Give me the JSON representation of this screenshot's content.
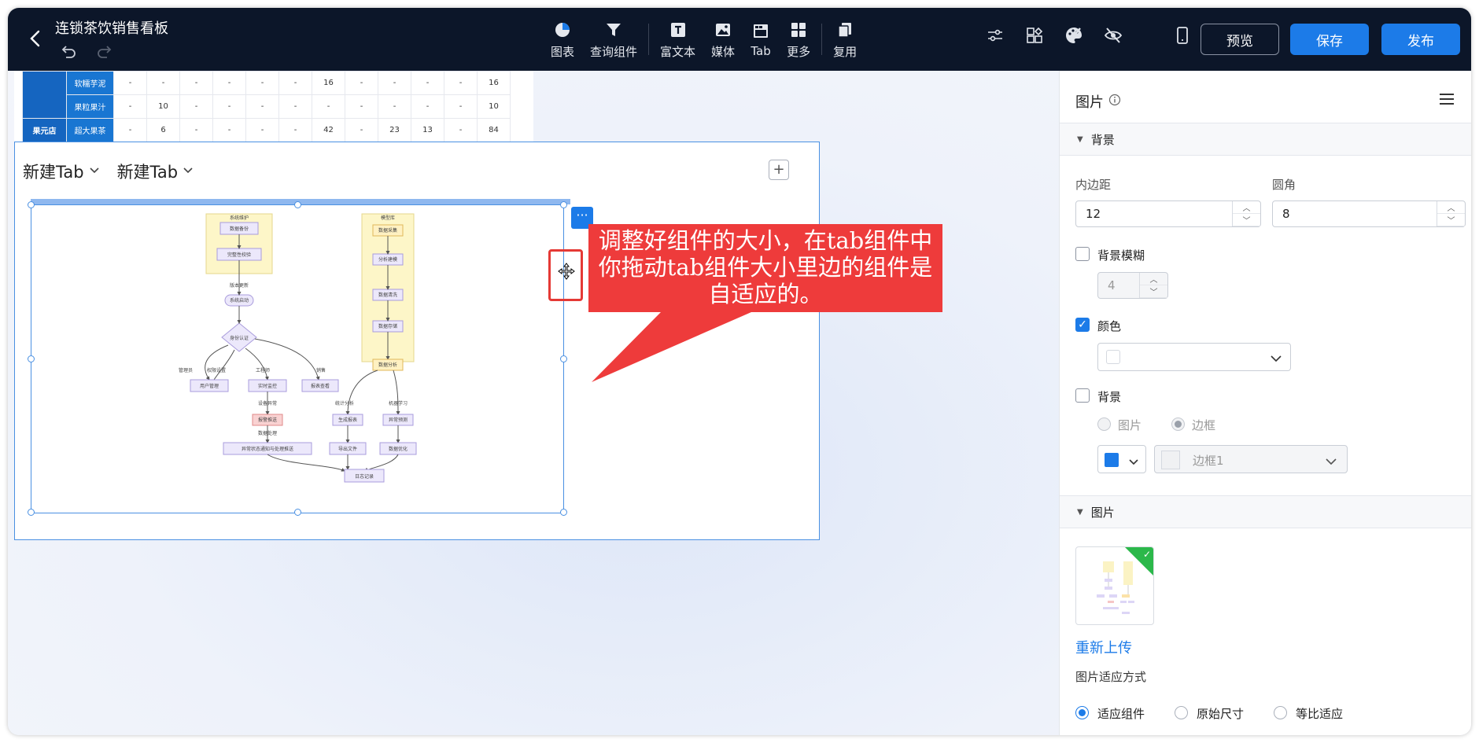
{
  "header": {
    "title": "连锁茶饮销售看板",
    "tools": [
      {
        "label": "图表",
        "icon": "chart-icon"
      },
      {
        "label": "查询组件",
        "icon": "filter-icon"
      },
      {
        "label": "富文本",
        "icon": "rich-text-icon"
      },
      {
        "label": "媒体",
        "icon": "media-icon"
      },
      {
        "label": "Tab",
        "icon": "tab-icon"
      },
      {
        "label": "更多",
        "icon": "more-grid-icon"
      },
      {
        "label": "复用",
        "icon": "reuse-icon"
      }
    ],
    "preview_label": "预览",
    "save_label": "保存",
    "publish_label": "发布"
  },
  "table": {
    "store_label": "果元店",
    "rows": [
      {
        "item": "软糯芋泥",
        "cells": [
          "-",
          "-",
          "-",
          "-",
          "-",
          "-",
          "16",
          "-",
          "-",
          "-",
          "-",
          "16"
        ]
      },
      {
        "item": "果粒果汁",
        "cells": [
          "-",
          "10",
          "-",
          "-",
          "-",
          "-",
          "-",
          "-",
          "-",
          "-",
          "-",
          "10"
        ]
      },
      {
        "item": "超大果茶",
        "cells": [
          "-",
          "6",
          "-",
          "-",
          "-",
          "-",
          "42",
          "-",
          "23",
          "13",
          "-",
          "84"
        ]
      }
    ]
  },
  "tabs": [
    {
      "label": "新建Tab"
    },
    {
      "label": "新建Tab"
    }
  ],
  "add_tab_label": "+",
  "more_button_label": "···",
  "callout_text": "调整好组件的大小，在tab组件中你拖动tab组件大小里边的组件是自适应的。",
  "flowchart": {
    "group_left_title": "系统维护",
    "group_right_title": "模型库",
    "nodes": {
      "n1": "数据备份",
      "n2": "完整性校验",
      "e1": "版本更新",
      "n3": "系统启动",
      "d1": "身份认证",
      "e2": "管理员",
      "e3": "权限设置",
      "e4": "工程师",
      "e5": "销售",
      "n4": "用户管理",
      "n5": "实时监控",
      "n6": "报表查看",
      "r1": "数据采集",
      "r2": "分析建模",
      "r3": "数据清洗",
      "r4": "数据存储",
      "n7": "数据分析",
      "e6": "设备异常",
      "n8": "报警推送",
      "e7": "数据处理",
      "e8": "统计分析",
      "e9": "机器学习",
      "n9": "生成报表",
      "n10": "异常预测",
      "n11": "异常状态通知与处理推送",
      "n12": "导出文件",
      "n13": "数据优化",
      "n14": "日志记录"
    }
  },
  "panel": {
    "title": "图片",
    "section_background": "背景",
    "padding_label": "内边距",
    "padding_value": "12",
    "radius_label": "圆角",
    "radius_value": "8",
    "blur_label": "背景模糊",
    "blur_value": "4",
    "color_label": "颜色",
    "bg_label": "背景",
    "bg_image_option": "图片",
    "bg_border_option": "边框",
    "border_select_value": "边框1",
    "section_image": "图片",
    "reupload_label": "重新上传",
    "fit_label": "图片适应方式",
    "fit_options": [
      "适应组件",
      "原始尺寸",
      "等比适应"
    ]
  },
  "colors": {
    "topbar": "#0c1629",
    "accent": "#1c7be8",
    "callout": "#ee3b3b",
    "table_header": "#1976d2"
  }
}
